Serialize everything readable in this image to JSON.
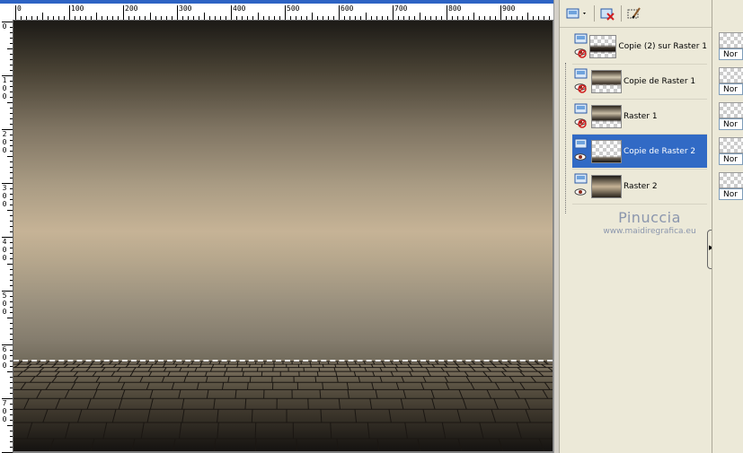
{
  "ruler": {
    "top_labels": [
      "0",
      "100",
      "200",
      "300",
      "400",
      "500",
      "600",
      "700",
      "800",
      "900"
    ],
    "left_labels": [
      "0",
      "1\n0\n0",
      "2\n0\n0",
      "3\n0\n0",
      "4\n0\n0",
      "5\n0\n0",
      "6\n0\n0",
      "7\n0\n0"
    ]
  },
  "toolbar": {
    "new_layer_icon": "new-layer-icon",
    "delete_layer_icon": "delete-layer-icon",
    "edit_icon": "edit-brush-icon"
  },
  "layers": [
    {
      "name": "Copie (2) sur Raster 1",
      "visible": false,
      "selected": false
    },
    {
      "name": "Copie de Raster 1",
      "visible": false,
      "selected": false
    },
    {
      "name": "Raster 1",
      "visible": false,
      "selected": false
    },
    {
      "name": "Copie de Raster 2",
      "visible": true,
      "selected": true
    },
    {
      "name": "Raster 2",
      "visible": true,
      "selected": false
    }
  ],
  "watermark": {
    "name": "Pinuccia",
    "url": "www.maidiregrafica.eu"
  },
  "blend_panel": {
    "modes": [
      "Nor",
      "Nor",
      "Nor",
      "Nor",
      "Nor"
    ]
  },
  "colors": {
    "selection": "#316ac5",
    "watermark": "#8b96ad"
  }
}
